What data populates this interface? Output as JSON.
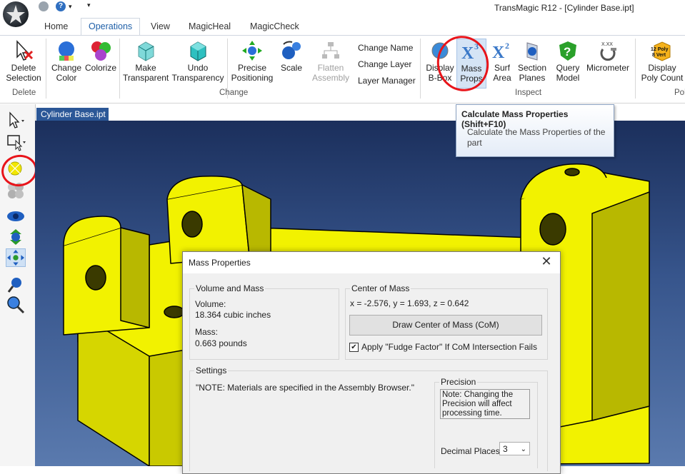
{
  "app": {
    "title": "TransMagic R12 - [Cylinder Base.ipt]",
    "quick_access": [
      "gear-icon",
      "help-icon",
      "dropdown-icon"
    ]
  },
  "tabs": [
    {
      "label": "Home",
      "active": false
    },
    {
      "label": "Operations",
      "active": true
    },
    {
      "label": "View",
      "active": false
    },
    {
      "label": "MagicHeal",
      "active": false
    },
    {
      "label": "MagicCheck",
      "active": false
    }
  ],
  "ribbon": {
    "delete_selection": {
      "label1": "Delete",
      "label2": "Selection"
    },
    "group_delete": "Delete",
    "change_color": {
      "label1": "Change",
      "label2": "Color"
    },
    "colorize": {
      "label1": "Colorize"
    },
    "make_transparent": {
      "label1": "Make",
      "label2": "Transparent"
    },
    "undo_transparency": {
      "label1": "Undo",
      "label2": "Transparency"
    },
    "precise_positioning": {
      "label1": "Precise",
      "label2": "Positioning"
    },
    "scale": {
      "label1": "Scale"
    },
    "flatten_assembly": {
      "label1": "Flatten",
      "label2": "Assembly"
    },
    "change_name": "Change Name",
    "change_layer": "Change Layer",
    "layer_manager": "Layer Manager",
    "group_change": "Change",
    "display_bbox": {
      "label1": "Display",
      "label2": "B-Box"
    },
    "mass_props": {
      "label1": "Mass",
      "label2": "Props"
    },
    "surf_area": {
      "label1": "Surf",
      "label2": "Area"
    },
    "section_planes": {
      "label1": "Section",
      "label2": "Planes"
    },
    "query_model": {
      "label1": "Query",
      "label2": "Model"
    },
    "micrometer": {
      "label1": "Micrometer"
    },
    "group_inspect": "Inspect",
    "display_poly_count": {
      "label1": "Display",
      "label2": "Poly Count"
    },
    "poly_badge1": "12 Poly",
    "poly_badge2": "8 Vert",
    "group_poly": "Pol",
    "micrometer_badge": "X.XX"
  },
  "document_tab": "Cylinder Base.ipt",
  "tooltip": {
    "title": "Calculate Mass Properties (Shift+F10)",
    "body": "Calculate the Mass Properties of the part"
  },
  "dialog": {
    "title": "Mass Properties",
    "volume_mass_legend": "Volume and Mass",
    "volume_label": "Volume:",
    "volume_value": "18.364  cubic inches",
    "mass_label": "Mass:",
    "mass_value": "0.663 pounds",
    "com_legend": "Center of Mass",
    "com_value": "x = -2.576, y = 1.693, z = 0.642",
    "draw_com_button": "Draw Center of Mass (CoM)",
    "fudge_checkbox_label": "Apply \"Fudge Factor\" If CoM Intersection Fails",
    "fudge_checked": true,
    "settings_legend": "Settings",
    "settings_note": "\"NOTE: Materials are specified in the Assembly Browser.\"",
    "precision_legend": "Precision",
    "precision_note": "Note: Changing the Precision will affect processing time.",
    "decimal_places_label": "Decimal Places:",
    "decimal_places_value": "3"
  },
  "colors": {
    "model_yellow": "#f2f200",
    "viewport_top": "#1b2f5c",
    "viewport_bottom": "#5a7aae",
    "accent_tab": "#1e5fa8",
    "annotation_red": "#e8141a"
  }
}
